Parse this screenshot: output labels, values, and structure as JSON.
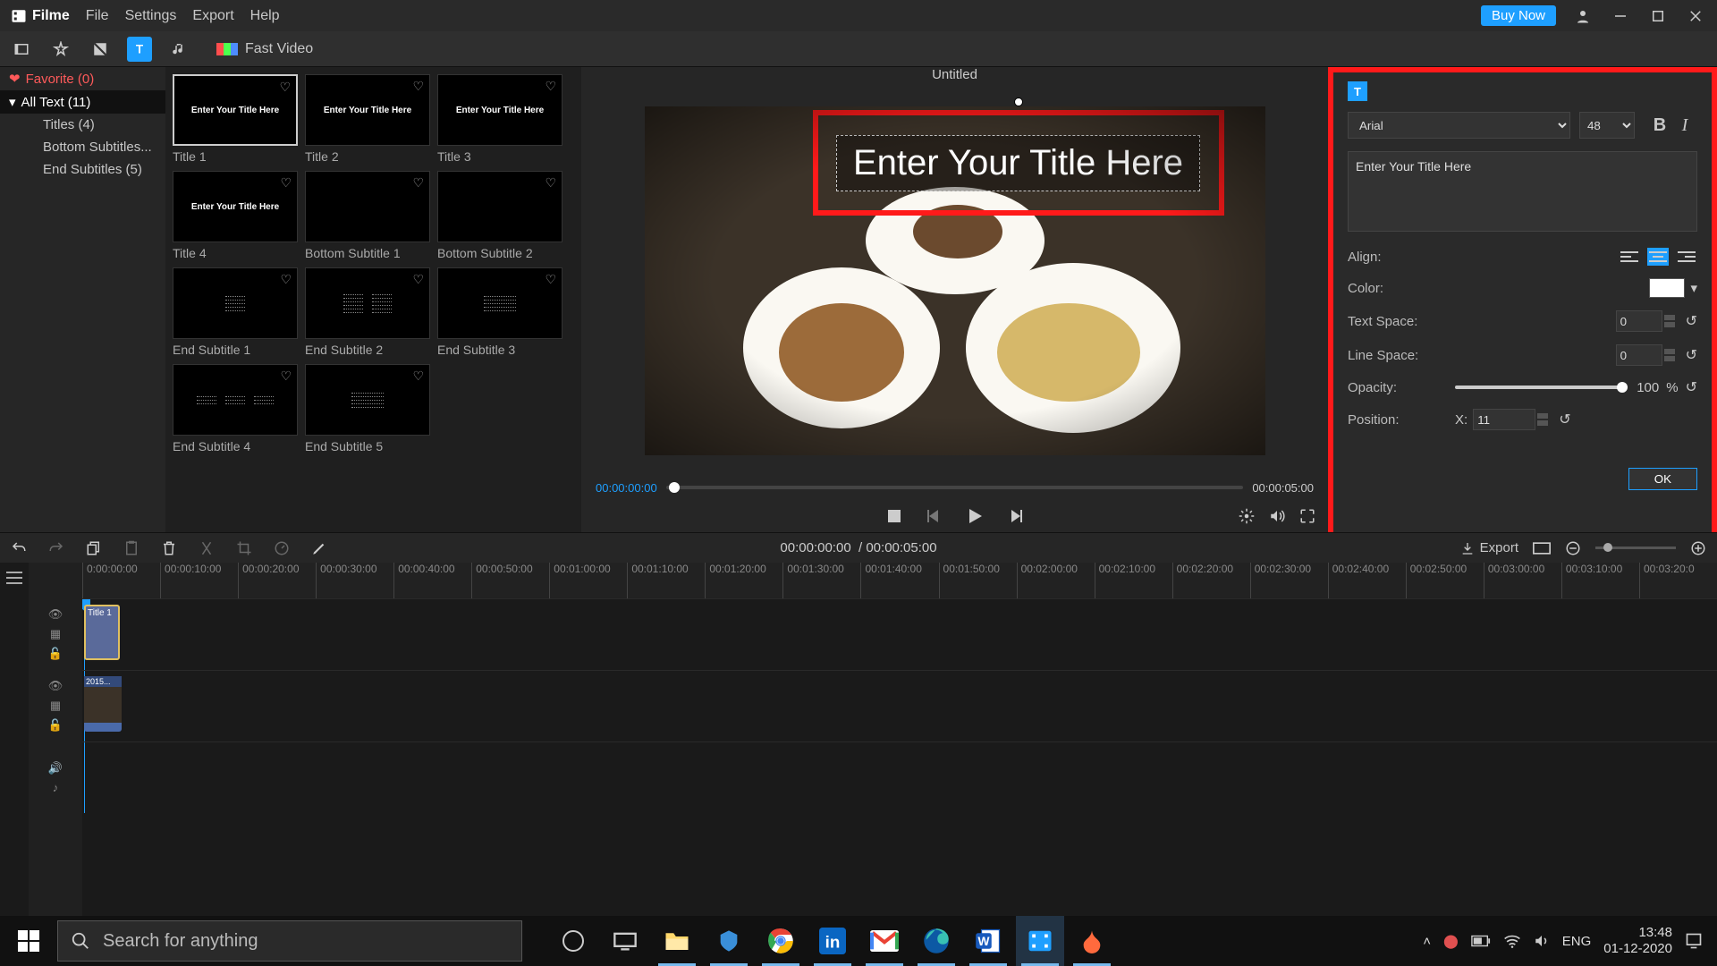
{
  "app": {
    "name": "Filme"
  },
  "menu": {
    "file": "File",
    "settings": "Settings",
    "export": "Export",
    "help": "Help",
    "buy_now": "Buy Now"
  },
  "toolbar": {
    "fast_video": "Fast Video"
  },
  "sidebar": {
    "favorite": "Favorite (0)",
    "items": [
      {
        "label": "All Text (11)",
        "selected": true
      },
      {
        "label": "Titles (4)"
      },
      {
        "label": "Bottom Subtitles..."
      },
      {
        "label": "End Subtitles (5)"
      }
    ]
  },
  "gallery": {
    "items": [
      {
        "label": "Title 1",
        "preview_text": "Enter Your Title Here",
        "style": "text",
        "selected": true
      },
      {
        "label": "Title 2",
        "preview_text": "Enter Your Title Here",
        "style": "text"
      },
      {
        "label": "Title 3",
        "preview_text": "Enter Your Title Here",
        "style": "text"
      },
      {
        "label": "Title 4",
        "preview_text": "Enter Your Title Here",
        "style": "text"
      },
      {
        "label": "Bottom Subtitle 1",
        "style": "blank"
      },
      {
        "label": "Bottom Subtitle 2",
        "style": "blank"
      },
      {
        "label": "End Subtitle 1",
        "style": "lines3"
      },
      {
        "label": "End Subtitle 2",
        "style": "cols2"
      },
      {
        "label": "End Subtitle 3",
        "style": "col_right"
      },
      {
        "label": "End Subtitle 4",
        "style": "blocks"
      },
      {
        "label": "End Subtitle 5",
        "style": "col_right"
      }
    ]
  },
  "preview": {
    "title": "Untitled",
    "overlay_text": "Enter Your Title Here",
    "time_current": "00:00:00:00",
    "time_total": "00:00:05:00"
  },
  "props": {
    "font": "Arial",
    "size": "48",
    "text": "Enter Your Title Here",
    "align_label": "Align:",
    "color_label": "Color:",
    "color": "#ffffff",
    "text_space_label": "Text Space:",
    "text_space": "0",
    "line_space_label": "Line Space:",
    "line_space": "0",
    "opacity_label": "Opacity:",
    "opacity": "100",
    "opacity_unit": "%",
    "position_label": "Position:",
    "pos_x_label": "X:",
    "pos_x": "11",
    "ok": "OK"
  },
  "timeline_toolbar": {
    "time_current": "00:00:00:00",
    "time_total": "00:00:05:00",
    "export": "Export"
  },
  "ruler": [
    "0:00:00:00",
    "00:00:10:00",
    "00:00:20:00",
    "00:00:30:00",
    "00:00:40:00",
    "00:00:50:00",
    "00:01:00:00",
    "00:01:10:00",
    "00:01:20:00",
    "00:01:30:00",
    "00:01:40:00",
    "00:01:50:00",
    "00:02:00:00",
    "00:02:10:00",
    "00:02:20:00",
    "00:02:30:00",
    "00:02:40:00",
    "00:02:50:00",
    "00:03:00:00",
    "00:03:10:00",
    "00:03:20:0"
  ],
  "clips": {
    "title": "Title 1",
    "video": "2015..."
  },
  "taskbar": {
    "search_placeholder": "Search for anything",
    "lang": "ENG",
    "time": "13:48",
    "date": "01-12-2020"
  }
}
